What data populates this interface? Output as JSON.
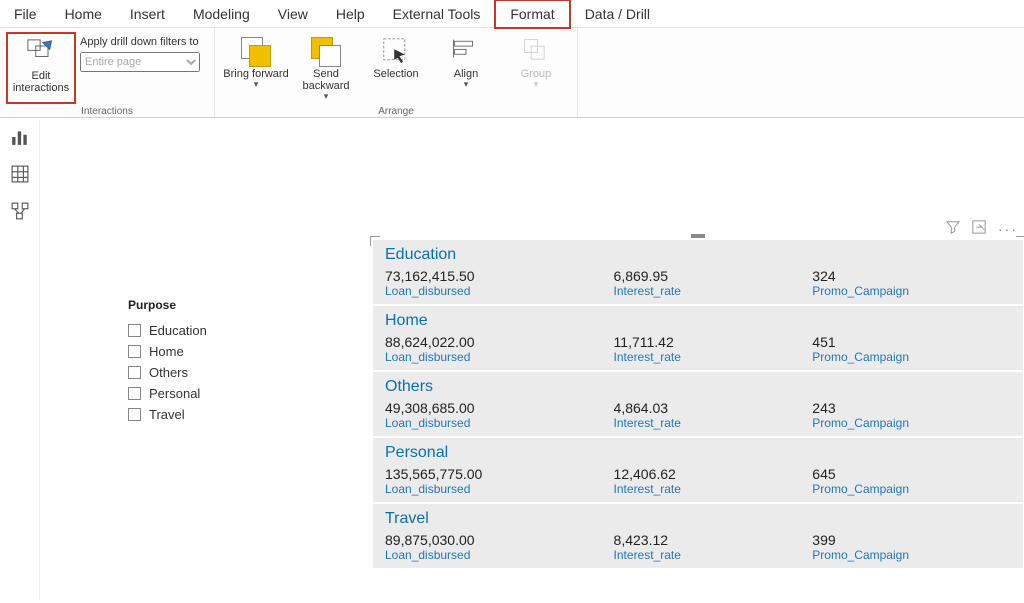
{
  "menubar": {
    "items": [
      "File",
      "Home",
      "Insert",
      "Modeling",
      "View",
      "Help",
      "External Tools",
      "Format",
      "Data / Drill"
    ],
    "active_index": 7
  },
  "ribbon": {
    "edit_interactions": "Edit interactions",
    "drill_label": "Apply drill down filters to",
    "drill_placeholder": "Entire page",
    "bring_forward": "Bring forward",
    "send_backward": "Send backward",
    "selection": "Selection",
    "align": "Align",
    "group": "Group",
    "section_interactions": "Interactions",
    "section_arrange": "Arrange"
  },
  "slicer": {
    "title": "Purpose",
    "items": [
      "Education",
      "Home",
      "Others",
      "Personal",
      "Travel"
    ]
  },
  "visual": {
    "cards": [
      {
        "title": "Education",
        "cols": [
          {
            "value": "73,162,415.50",
            "label": "Loan_disbursed"
          },
          {
            "value": "6,869.95",
            "label": "Interest_rate"
          },
          {
            "value": "324",
            "label": "Promo_Campaign"
          }
        ]
      },
      {
        "title": "Home",
        "cols": [
          {
            "value": "88,624,022.00",
            "label": "Loan_disbursed"
          },
          {
            "value": "11,711.42",
            "label": "Interest_rate"
          },
          {
            "value": "451",
            "label": "Promo_Campaign"
          }
        ]
      },
      {
        "title": "Others",
        "cols": [
          {
            "value": "49,308,685.00",
            "label": "Loan_disbursed"
          },
          {
            "value": "4,864.03",
            "label": "Interest_rate"
          },
          {
            "value": "243",
            "label": "Promo_Campaign"
          }
        ]
      },
      {
        "title": "Personal",
        "cols": [
          {
            "value": "135,565,775.00",
            "label": "Loan_disbursed"
          },
          {
            "value": "12,406.62",
            "label": "Interest_rate"
          },
          {
            "value": "645",
            "label": "Promo_Campaign"
          }
        ]
      },
      {
        "title": "Travel",
        "cols": [
          {
            "value": "89,875,030.00",
            "label": "Loan_disbursed"
          },
          {
            "value": "8,423.12",
            "label": "Interest_rate"
          },
          {
            "value": "399",
            "label": "Promo_Campaign"
          }
        ]
      }
    ]
  }
}
